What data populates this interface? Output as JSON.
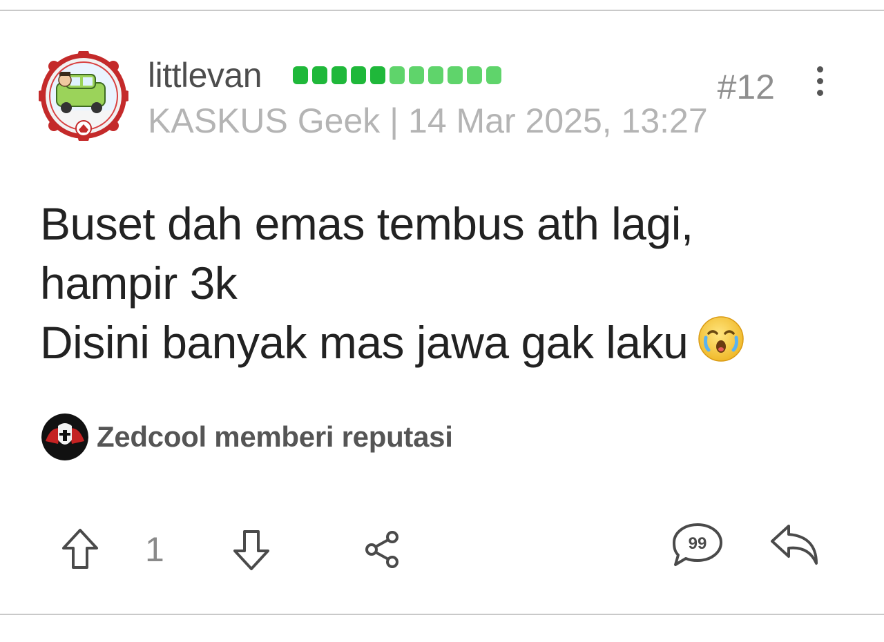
{
  "post": {
    "username": "littlevan",
    "post_number": "#12",
    "meta": "KASKUS Geek | 14 Mar 2025, 13:27",
    "rank_segments": {
      "filled": 5,
      "total": 11
    },
    "body_lines": [
      "Buset dah emas tembus ath lagi,",
      "hampir 3k",
      "Disini banyak mas jawa gak laku"
    ],
    "emoji": "crying-face-emoji",
    "reputation_text": "Zedcool memberi reputasi",
    "vote_count": "1"
  },
  "icons": {
    "more": "more-vertical-icon",
    "upvote": "arrow-up-icon",
    "downvote": "arrow-down-icon",
    "share": "share-icon",
    "quote": "quote-icon",
    "reply": "reply-icon"
  },
  "colors": {
    "rank_dark": "#1fb83a",
    "rank_light": "#5fd46b",
    "username": "#4d4d4d",
    "meta": "#b4b4b4",
    "body": "#222222",
    "divider": "#c9c9c9"
  }
}
